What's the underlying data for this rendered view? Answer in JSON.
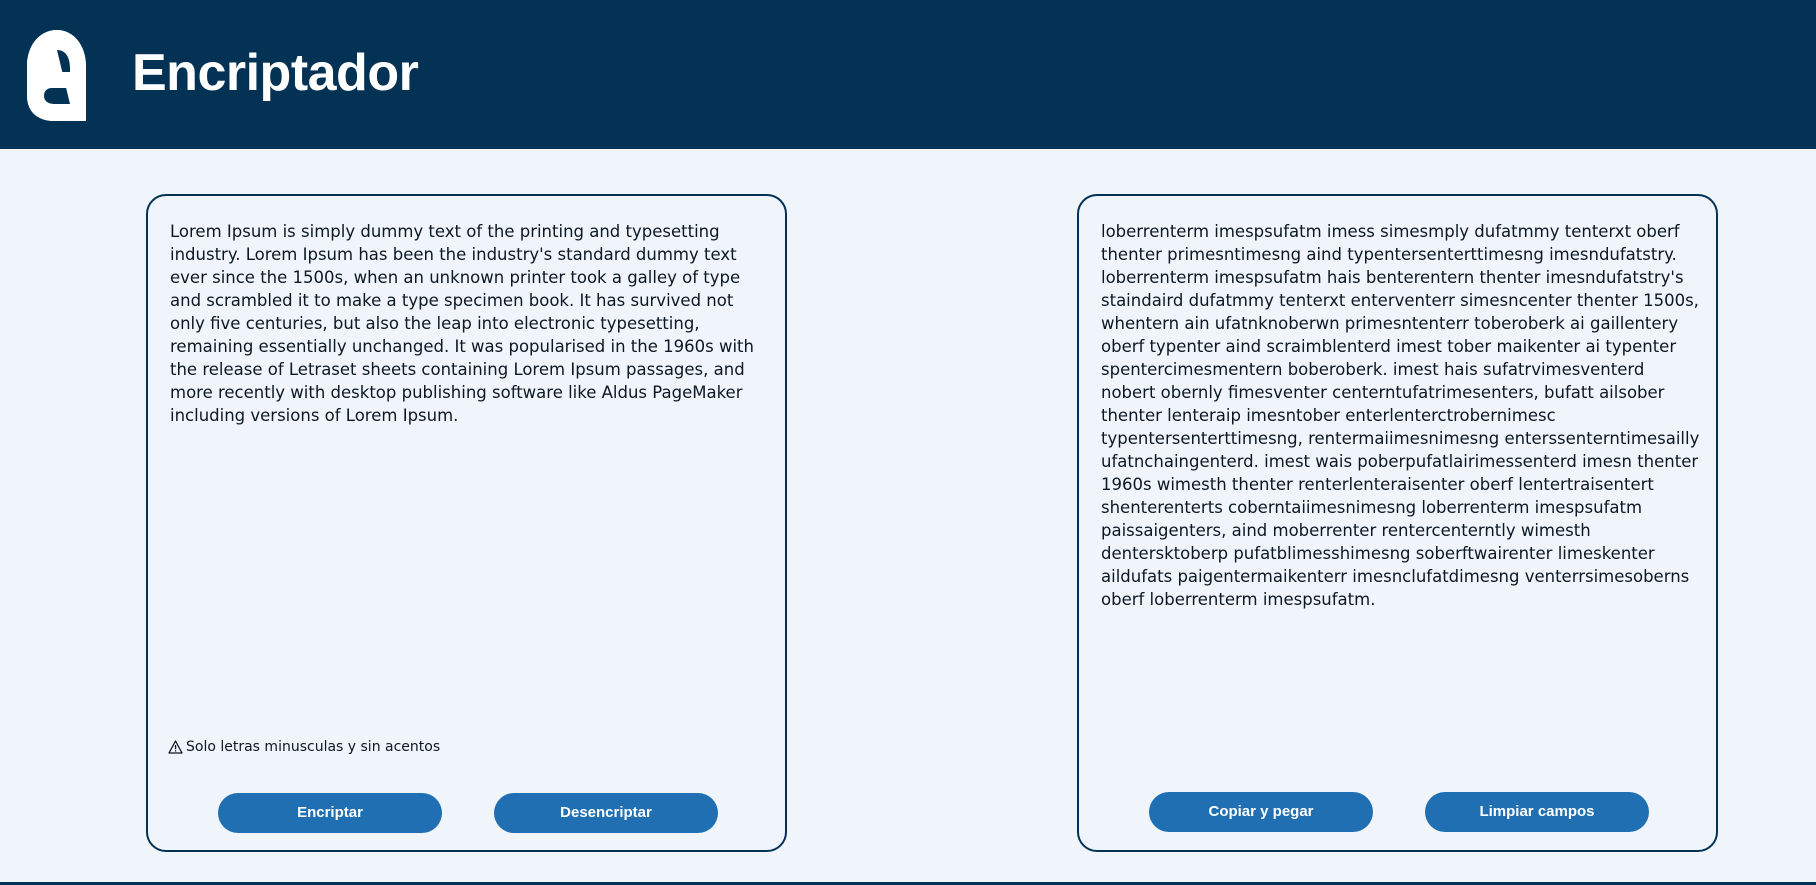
{
  "header": {
    "title": "Encriptador",
    "logo_icon": "letter-a-logo",
    "background_color": "#033255"
  },
  "input_panel": {
    "text": "Lorem Ipsum is simply dummy text of the printing and typesetting industry. Lorem Ipsum has been the industry's standard dummy text ever since the 1500s, when an unknown printer took a galley of type and scrambled it to make a type specimen book. It has survived not only five centuries, but also the leap into electronic typesetting, remaining essentially unchanged. It was popularised in the 1960s with the release of Letraset sheets containing Lorem Ipsum passages, and more recently with desktop publishing software like Aldus PageMaker including versions of Lorem Ipsum.",
    "warning_icon": "warning-triangle-icon",
    "warning_text": "Solo letras minusculas y sin acentos",
    "encrypt_label": "Encriptar",
    "decrypt_label": "Desencriptar"
  },
  "output_panel": {
    "text": "loberrenterm imespsufatm imess simesmply dufatmmy tenterxt oberf thenter primesntimesng aind typentersenterttimesng imesndufatstry. loberrenterm imespsufatm hais benterentern thenter imesndufatstry's staindaird dufatmmy tenterxt enterventerr simesncenter thenter 1500s, whentern ain ufatnknoberwn primesntenterr toberoberk ai gaillentery oberf typenter aind scraimblenterd imest tober maikenter ai typenter spentercimesmentern boberoberk. imest hais sufatrvimesventerd nobert obernly fimesventer centerntufatrimesenters, bufatt ailsober thenter lenteraip imesntober enterlenterctrobernimesc typentersenterttimesng, rentermaiimesnimesng enterssenterntimesailly ufatnchaingenterd. imest wais poberpufatlairimessenterd imesn thenter 1960s wimesth thenter renterlenteraisenter oberf lentertraisentert shenterenterts coberntaiimesnimesng loberrenterm imespsufatm paissaigenters, aind moberrenter rentercenterntly wimesth dentersktoberp pufatblimesshimesng soberftwairenter limeskenter aildufats paigentermaikenterr imesnclufatdimesng venterrsimesoberns oberf loberrenterm imespsufatm.",
    "copy_label": "Copiar y pegar",
    "clear_label": "Limpiar campos"
  },
  "colors": {
    "accent": "#1f6fb2",
    "background": "#f0f4fb",
    "border": "#033255"
  }
}
